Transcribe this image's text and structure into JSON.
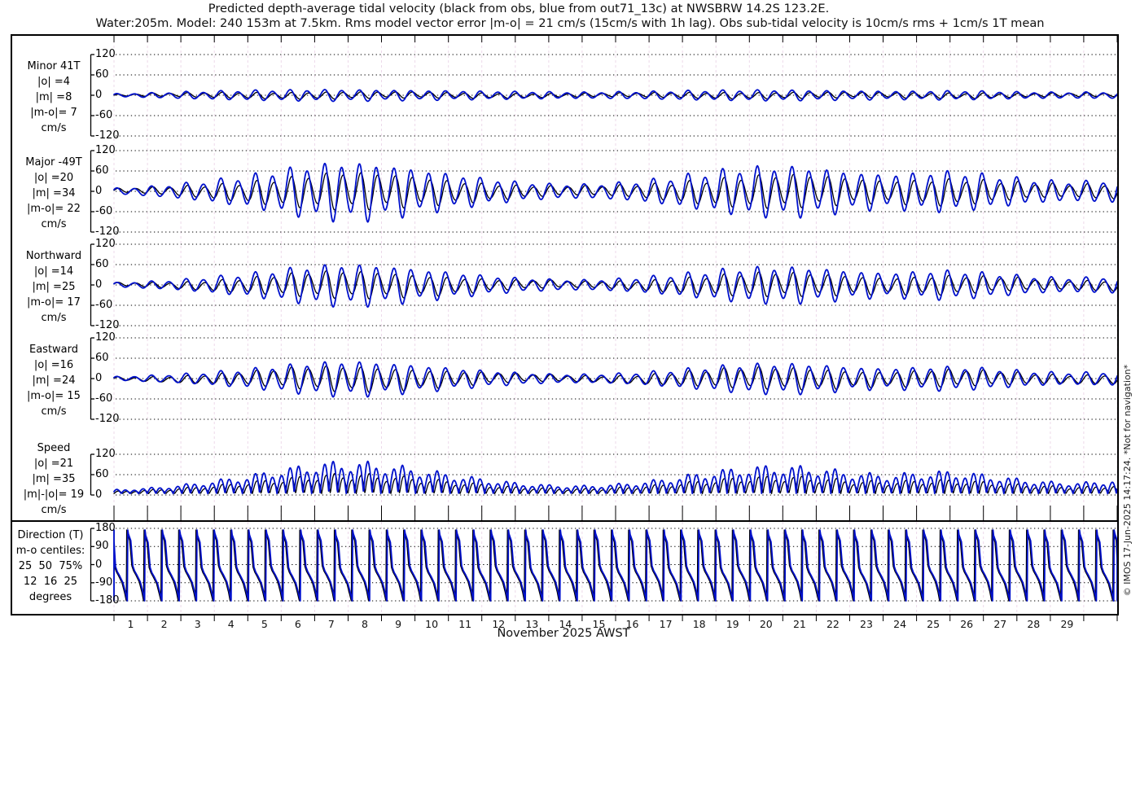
{
  "title": {
    "line1": "Predicted depth-average tidal velocity (black from obs, blue from out71_13c) at NWSBRW 14.2S 123.2E.",
    "line2": "Water:205m. Model: 240 153m at 7.5km. Rms model vector error |m-o| = 21 cm/s (15cm/s with 1h lag). Obs sub-tidal velocity is 10cm/s rms + 1cm/s 1T mean"
  },
  "watermark": "© IMOS 17-Jun-2025 14:17:24. *Not for navigation*",
  "x_axis": {
    "month_label": "November 2025 AWST",
    "day_labels": [
      "1",
      "2",
      "3",
      "4",
      "5",
      "6",
      "7",
      "8",
      "9",
      "10",
      "11",
      "12",
      "13",
      "14",
      "15",
      "16",
      "17",
      "18",
      "19",
      "20",
      "21",
      "22",
      "23",
      "24",
      "25",
      "26",
      "27",
      "28",
      "29"
    ],
    "start_day": 0,
    "end_day": 30
  },
  "colors": {
    "obs": "#000000",
    "model": "#0011cc",
    "grid_vertical": "#edd9ea",
    "grid_dots": "#000000",
    "frame": "#000000"
  },
  "chart_data": [
    {
      "type": "line",
      "name": "minor",
      "waveform": "sinusoid",
      "period_days": 0.5175,
      "label_lines": [
        "Minor 41T",
        "|o| =4",
        "|m| =8",
        "|m-o|= 7",
        "cm/s"
      ],
      "ylim": [
        -120,
        120
      ],
      "yticks": [
        120,
        60,
        0,
        -60,
        -120
      ],
      "series": [
        {
          "name": "obs",
          "color": "#000000",
          "lag_days": 0,
          "drift": 1.5,
          "envelope_by_day": [
            2,
            4,
            5,
            7,
            8,
            8,
            9,
            9,
            8,
            8,
            7,
            7,
            6,
            5,
            5,
            5,
            6,
            7,
            8,
            8,
            8,
            8,
            7,
            7,
            7,
            7,
            7,
            5,
            5,
            5,
            5
          ]
        },
        {
          "name": "model",
          "color": "#0011cc",
          "lag_days": 0.042,
          "drift": 0,
          "envelope_by_day": [
            4,
            6,
            9,
            11,
            13,
            14,
            15,
            15,
            14,
            13,
            12,
            11,
            10,
            9,
            8,
            9,
            10,
            12,
            13,
            14,
            14,
            13,
            12,
            11,
            11,
            12,
            11,
            9,
            8,
            8,
            9
          ]
        }
      ]
    },
    {
      "type": "line",
      "name": "major",
      "waveform": "sinusoid",
      "period_days": 0.5175,
      "label_lines": [
        "Major -49T",
        "|o| =20",
        "|m| =34",
        "|m-o|= 22",
        "cm/s"
      ],
      "ylim": [
        -120,
        120
      ],
      "yticks": [
        120,
        60,
        0,
        -60,
        -120
      ],
      "series": [
        {
          "name": "obs",
          "color": "#000000",
          "lag_days": 0,
          "drift": 3,
          "envelope_by_day": [
            5,
            8,
            13,
            19,
            27,
            36,
            45,
            50,
            46,
            39,
            31,
            24,
            17,
            13,
            12,
            14,
            19,
            27,
            35,
            42,
            44,
            41,
            34,
            29,
            32,
            35,
            30,
            23,
            18,
            17,
            22
          ]
        },
        {
          "name": "model",
          "color": "#0011cc",
          "lag_days": 0.042,
          "drift": 0,
          "envelope_by_day": [
            8,
            12,
            20,
            30,
            42,
            58,
            72,
            78,
            72,
            60,
            48,
            36,
            26,
            20,
            18,
            22,
            30,
            42,
            55,
            65,
            68,
            63,
            52,
            45,
            50,
            54,
            46,
            36,
            28,
            26,
            34
          ]
        }
      ]
    },
    {
      "type": "line",
      "name": "northward",
      "waveform": "sinusoid",
      "period_days": 0.5175,
      "label_lines": [
        "Northward",
        "|o| =14",
        "|m| =25",
        "|m-o|= 17",
        "cm/s"
      ],
      "ylim": [
        -120,
        120
      ],
      "yticks": [
        120,
        60,
        0,
        -60,
        -120
      ],
      "series": [
        {
          "name": "obs",
          "color": "#000000",
          "lag_days": 0,
          "drift": 3,
          "envelope_by_day": [
            4,
            6,
            9,
            14,
            20,
            27,
            34,
            36,
            34,
            28,
            23,
            17,
            12,
            10,
            8,
            10,
            14,
            20,
            26,
            31,
            32,
            29,
            25,
            21,
            23,
            25,
            21,
            17,
            13,
            12,
            16
          ]
        },
        {
          "name": "model",
          "color": "#0011cc",
          "lag_days": 0.042,
          "drift": 0,
          "envelope_by_day": [
            6,
            9,
            14,
            22,
            30,
            42,
            52,
            56,
            52,
            43,
            35,
            26,
            19,
            15,
            13,
            16,
            22,
            30,
            40,
            47,
            49,
            45,
            38,
            32,
            36,
            39,
            33,
            26,
            20,
            19,
            25
          ]
        }
      ]
    },
    {
      "type": "line",
      "name": "eastward",
      "waveform": "sinusoid",
      "period_days": 0.5175,
      "label_lines": [
        "Eastward",
        "|o| =16",
        "|m| =24",
        "|m-o|= 15",
        "cm/s"
      ],
      "ylim": [
        -120,
        120
      ],
      "yticks": [
        120,
        60,
        0,
        -60,
        -120
      ],
      "series": [
        {
          "name": "obs",
          "color": "#000000",
          "lag_days": 0,
          "drift": 3,
          "envelope_by_day": [
            4,
            6,
            9,
            13,
            18,
            25,
            31,
            34,
            31,
            26,
            21,
            16,
            11,
            9,
            8,
            9,
            13,
            18,
            24,
            28,
            29,
            27,
            22,
            19,
            21,
            23,
            20,
            16,
            12,
            11,
            14
          ]
        },
        {
          "name": "model",
          "color": "#0011cc",
          "lag_days": 0.042,
          "drift": 0,
          "envelope_by_day": [
            5,
            8,
            12,
            18,
            25,
            35,
            43,
            47,
            43,
            36,
            29,
            22,
            16,
            12,
            11,
            13,
            18,
            25,
            33,
            39,
            41,
            38,
            31,
            27,
            30,
            32,
            28,
            22,
            17,
            16,
            20
          ]
        }
      ]
    },
    {
      "type": "line",
      "name": "speed",
      "waveform": "speed",
      "period_days": 0.5175,
      "label_lines": [
        "Speed",
        "|o| =21",
        "|m| =35",
        "|m|-|o|= 19",
        "cm/s"
      ],
      "ylim": [
        0,
        120
      ],
      "yticks": [
        120,
        60,
        0
      ],
      "series": [
        {
          "name": "obs",
          "color": "#000000",
          "lag_days": 0,
          "drift": 0,
          "envelope_by_day": [
            6,
            9,
            14,
            20,
            29,
            38,
            47,
            51,
            47,
            40,
            32,
            24,
            17,
            14,
            12,
            15,
            20,
            28,
            36,
            42,
            44,
            41,
            34,
            30,
            33,
            35,
            30,
            24,
            19,
            17,
            22
          ]
        },
        {
          "name": "model",
          "color": "#0011cc",
          "lag_days": 0.042,
          "drift": 0,
          "envelope_by_day": [
            10,
            14,
            22,
            33,
            46,
            62,
            76,
            82,
            76,
            64,
            51,
            38,
            28,
            22,
            20,
            24,
            32,
            45,
            58,
            68,
            71,
            66,
            55,
            48,
            53,
            57,
            49,
            38,
            30,
            28,
            36
          ]
        }
      ]
    },
    {
      "type": "line",
      "name": "direction",
      "waveform": "direction-sawtooth",
      "period_days": 0.5175,
      "label_lines": [
        "Direction (T)",
        "m-o centiles:",
        "25  50  75%",
        "12  16  25",
        "degrees"
      ],
      "ylim": [
        -180,
        180
      ],
      "yticks": [
        180,
        90,
        0,
        -90,
        -180
      ],
      "cycle_knots": [
        [
          0,
          -180
        ],
        [
          0.025,
          172
        ],
        [
          0.06,
          150
        ],
        [
          0.2,
          115
        ],
        [
          0.32,
          -10
        ],
        [
          0.42,
          -35
        ],
        [
          0.55,
          -55
        ],
        [
          0.75,
          -90
        ],
        [
          0.9,
          -140
        ],
        [
          1,
          -180
        ]
      ],
      "series": [
        {
          "name": "obs",
          "color": "#000000",
          "lag_days": 0
        },
        {
          "name": "model",
          "color": "#0011cc",
          "lag_days": 0.03
        }
      ]
    }
  ]
}
